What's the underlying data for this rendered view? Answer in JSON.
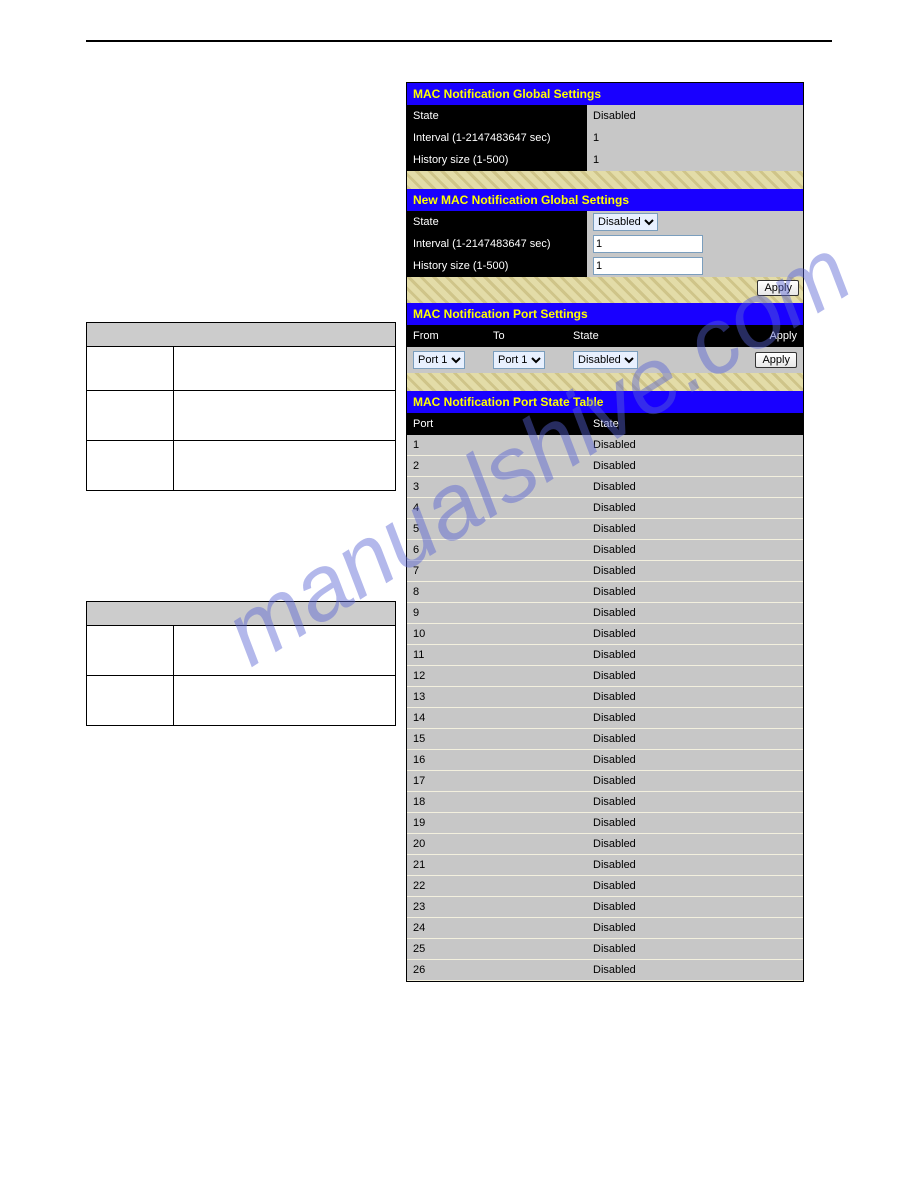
{
  "watermark": "manualshive.com",
  "panels": {
    "global": {
      "title": "MAC Notification Global Settings",
      "state_label": "State",
      "state_value": "Disabled",
      "interval_label": "Interval (1-2147483647 sec)",
      "interval_value": "1",
      "history_label": "History size (1-500)",
      "history_value": "1"
    },
    "new_global": {
      "title": "New MAC Notification Global Settings",
      "state_label": "State",
      "state_selected": "Disabled",
      "interval_label": "Interval (1-2147483647 sec)",
      "interval_value": "1",
      "history_label": "History size (1-500)",
      "history_value": "1",
      "apply_label": "Apply"
    },
    "port_settings": {
      "title": "MAC Notification Port Settings",
      "from_label": "From",
      "to_label": "To",
      "state_label": "State",
      "apply_label": "Apply",
      "from_selected": "Port 1",
      "to_selected": "Port 1",
      "state_selected": "Disabled",
      "btn_apply": "Apply"
    },
    "state_table": {
      "title": "MAC Notification Port State Table",
      "col_port": "Port",
      "col_state": "State",
      "rows": [
        {
          "port": "1",
          "state": "Disabled"
        },
        {
          "port": "2",
          "state": "Disabled"
        },
        {
          "port": "3",
          "state": "Disabled"
        },
        {
          "port": "4",
          "state": "Disabled"
        },
        {
          "port": "5",
          "state": "Disabled"
        },
        {
          "port": "6",
          "state": "Disabled"
        },
        {
          "port": "7",
          "state": "Disabled"
        },
        {
          "port": "8",
          "state": "Disabled"
        },
        {
          "port": "9",
          "state": "Disabled"
        },
        {
          "port": "10",
          "state": "Disabled"
        },
        {
          "port": "11",
          "state": "Disabled"
        },
        {
          "port": "12",
          "state": "Disabled"
        },
        {
          "port": "13",
          "state": "Disabled"
        },
        {
          "port": "14",
          "state": "Disabled"
        },
        {
          "port": "15",
          "state": "Disabled"
        },
        {
          "port": "16",
          "state": "Disabled"
        },
        {
          "port": "17",
          "state": "Disabled"
        },
        {
          "port": "18",
          "state": "Disabled"
        },
        {
          "port": "19",
          "state": "Disabled"
        },
        {
          "port": "20",
          "state": "Disabled"
        },
        {
          "port": "21",
          "state": "Disabled"
        },
        {
          "port": "22",
          "state": "Disabled"
        },
        {
          "port": "23",
          "state": "Disabled"
        },
        {
          "port": "24",
          "state": "Disabled"
        },
        {
          "port": "25",
          "state": "Disabled"
        },
        {
          "port": "26",
          "state": "Disabled"
        }
      ]
    }
  }
}
